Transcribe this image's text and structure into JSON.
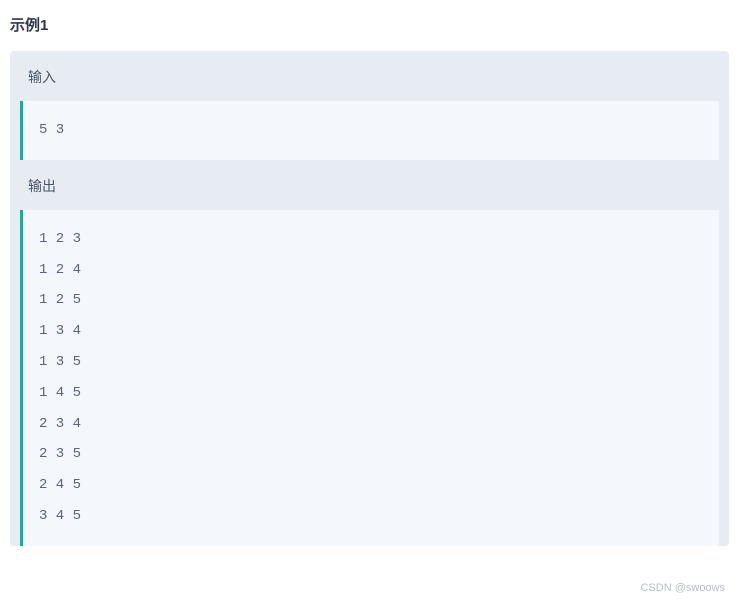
{
  "title": "示例1",
  "sections": [
    {
      "label": "输入",
      "content": "5 3"
    },
    {
      "label": "输出",
      "content": "1 2 3\n1 2 4\n1 2 5\n1 3 4\n1 3 5\n1 4 5\n2 3 4\n2 3 5\n2 4 5\n3 4 5"
    }
  ],
  "watermark": "CSDN @swoows"
}
